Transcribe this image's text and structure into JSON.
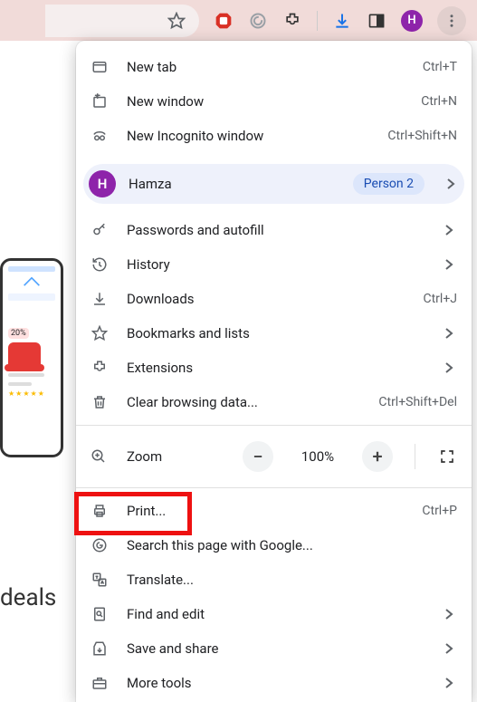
{
  "toolbar": {
    "avatar_letter": "H"
  },
  "menu": {
    "new_tab": {
      "label": "New tab",
      "shortcut": "Ctrl+T"
    },
    "new_window": {
      "label": "New window",
      "shortcut": "Ctrl+N"
    },
    "incognito": {
      "label": "New Incognito window",
      "shortcut": "Ctrl+Shift+N"
    },
    "profile": {
      "name": "Hamza",
      "badge": "Person 2",
      "avatar_letter": "H"
    },
    "passwords": {
      "label": "Passwords and autofill"
    },
    "history": {
      "label": "History"
    },
    "downloads": {
      "label": "Downloads",
      "shortcut": "Ctrl+J"
    },
    "bookmarks": {
      "label": "Bookmarks and lists"
    },
    "extensions": {
      "label": "Extensions"
    },
    "clear_data": {
      "label": "Clear browsing data...",
      "shortcut": "Ctrl+Shift+Del"
    },
    "zoom": {
      "label": "Zoom",
      "value": "100%"
    },
    "print": {
      "label": "Print...",
      "shortcut": "Ctrl+P"
    },
    "search_google": {
      "label": "Search this page with Google..."
    },
    "translate": {
      "label": "Translate..."
    },
    "find": {
      "label": "Find and edit"
    },
    "save_share": {
      "label": "Save and share"
    },
    "more_tools": {
      "label": "More tools"
    }
  },
  "page": {
    "deals_text": "deals",
    "discount_badge": "20%"
  },
  "highlight": {
    "target": "print"
  }
}
